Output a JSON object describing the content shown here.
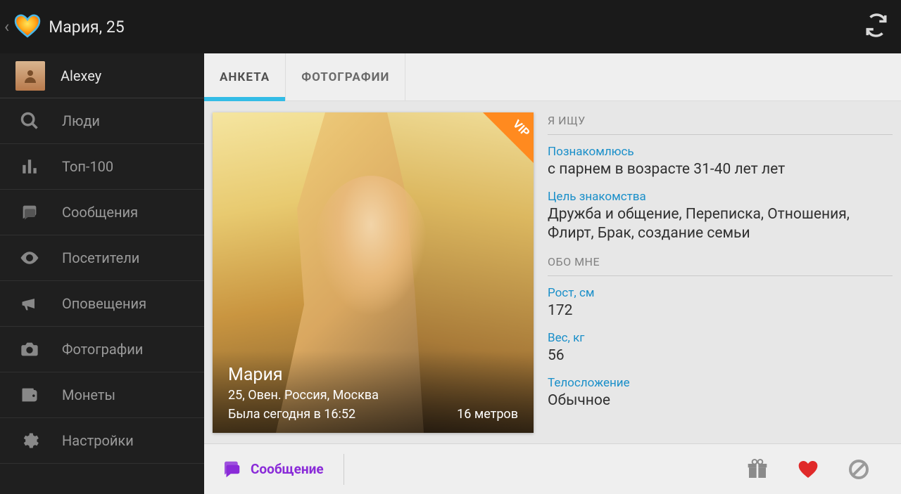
{
  "header": {
    "title": "Мария, 25"
  },
  "sidebar": {
    "user_name": "Alexey",
    "items": [
      {
        "label": "Люди",
        "icon": "search"
      },
      {
        "label": "Топ-100",
        "icon": "bars"
      },
      {
        "label": "Сообщения",
        "icon": "chat"
      },
      {
        "label": "Посетители",
        "icon": "eye"
      },
      {
        "label": "Оповещения",
        "icon": "megaphone"
      },
      {
        "label": "Фотографии",
        "icon": "camera"
      },
      {
        "label": "Монеты",
        "icon": "wallet"
      },
      {
        "label": "Настройки",
        "icon": "gear"
      }
    ]
  },
  "tabs": {
    "profile": "АНКЕТА",
    "photos": "ФОТОГРАФИИ"
  },
  "profile": {
    "vip": "VIP",
    "name": "Мария",
    "details": "25, Овен. Россия, Москва",
    "last_seen": "Была сегодня в 16:52",
    "distance": "16 метров",
    "looking_for": {
      "section": "Я ИЩУ",
      "meet_label": "Познакомлюсь",
      "meet_value": "с парнем в возрасте 31-40 лет лет",
      "purpose_label": "Цель знакомства",
      "purpose_value": "Дружба и общение, Переписка, Отношения, Флирт, Брак, создание семьи"
    },
    "about_me": {
      "section": "ОБО МНЕ",
      "height_label": "Рост, см",
      "height_value": "172",
      "weight_label": "Вес, кг",
      "weight_value": "56",
      "body_label": "Телосложение",
      "body_value": "Обычное"
    }
  },
  "bottom": {
    "message": "Сообщение"
  }
}
